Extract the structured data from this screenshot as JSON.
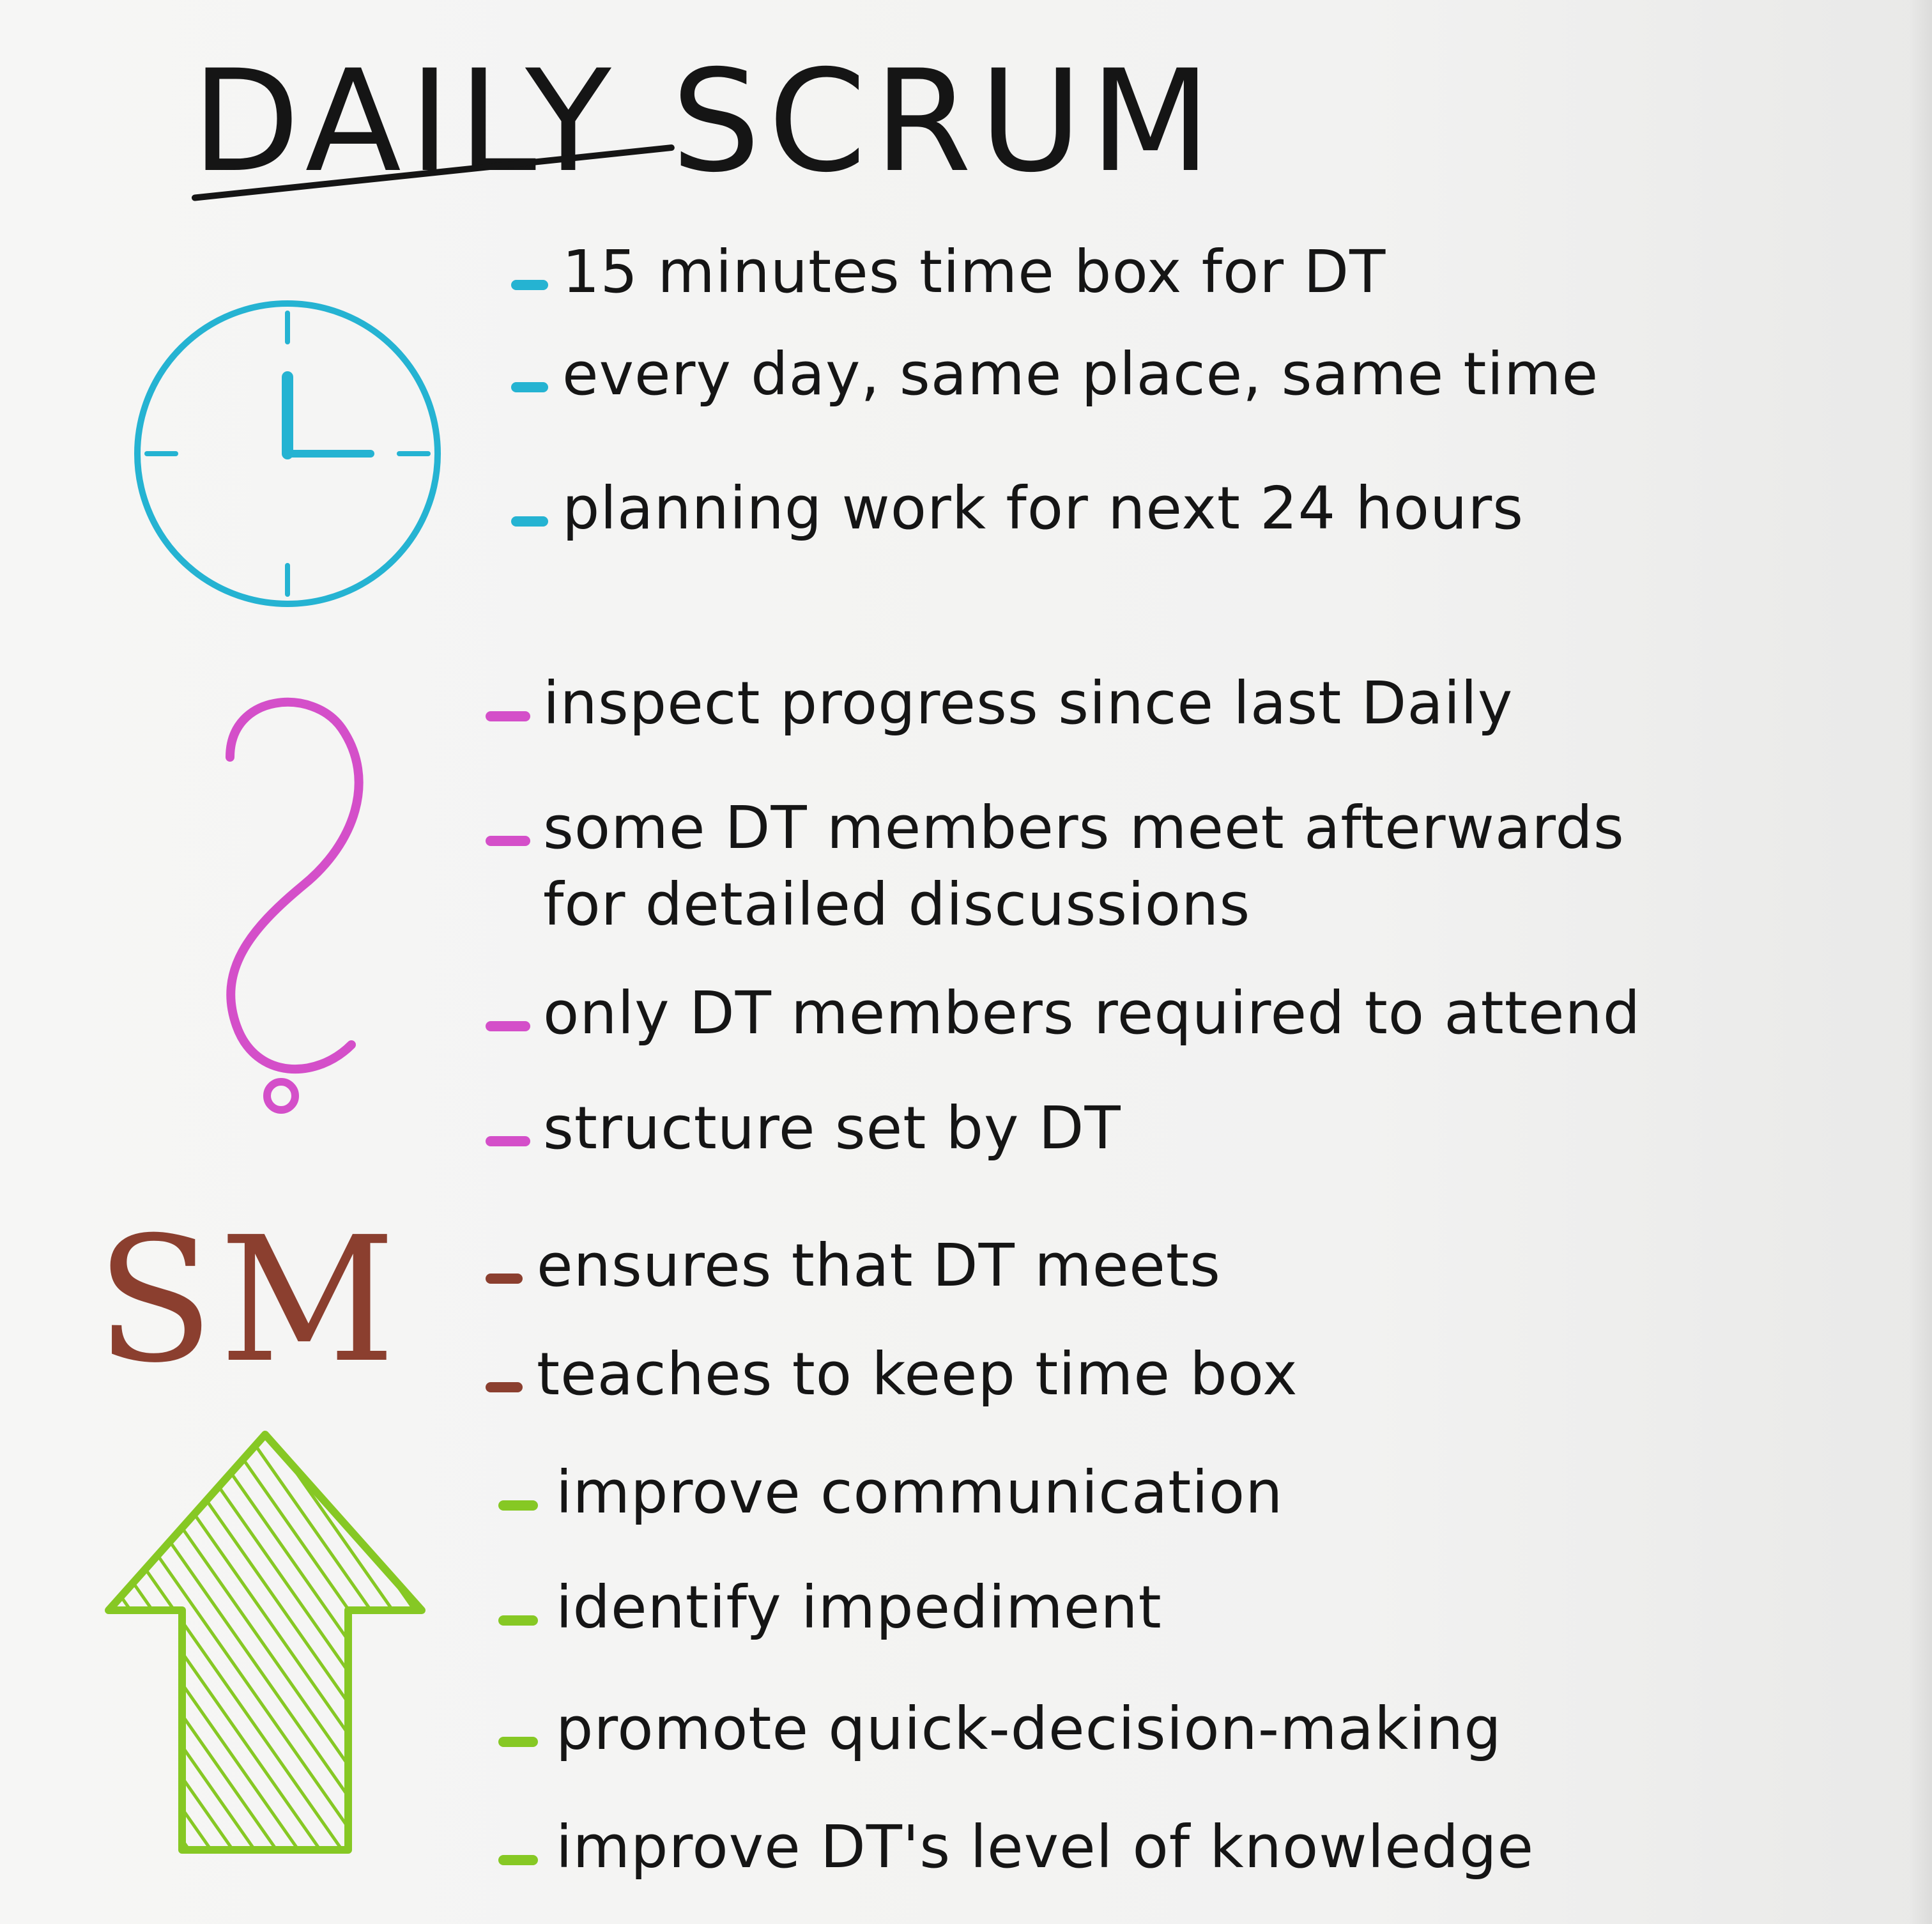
{
  "title": "DAILY SCRUM",
  "colors": {
    "ink": "#151515",
    "clock": "#25b3d2",
    "question": "#d44fc9",
    "sm": "#8b3f2f",
    "arrow": "#86c824"
  },
  "icons": {
    "clock": "clock-icon",
    "question": "question-mark-icon",
    "sm": "sm-label",
    "arrow": "up-arrow-icon"
  },
  "sections": {
    "timebox": {
      "items": [
        "15 minutes time box for DT",
        "every day, same place, same time",
        "planning work for next 24 hours"
      ]
    },
    "questions": {
      "items": [
        "inspect progress since last Daily",
        "some DT members meet afterwards",
        "for detailed discussions",
        "only DT members required to attend",
        "structure set by DT"
      ]
    },
    "sm": {
      "label": "SM",
      "items": [
        "ensures that DT meets",
        "teaches to keep time box"
      ]
    },
    "improve": {
      "items": [
        "improve communication",
        "identify impediment",
        "promote quick-decision-making",
        "improve DT's level of knowledge"
      ]
    }
  }
}
